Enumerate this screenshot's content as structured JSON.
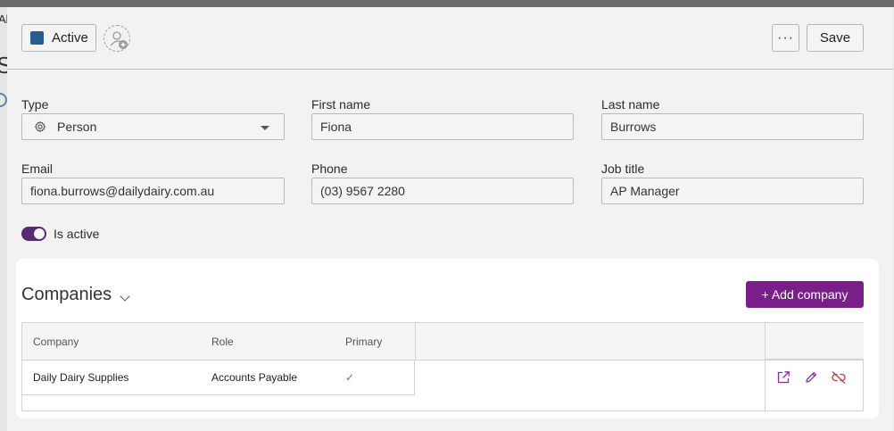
{
  "background": {
    "partial_text": "Al",
    "partial_heading": "S"
  },
  "header": {
    "status_label": "Active",
    "status_color": "#2a5d8f",
    "more_label": "···",
    "save_label": "Save"
  },
  "form": {
    "type": {
      "label": "Type",
      "value": "Person"
    },
    "first_name": {
      "label": "First name",
      "value": "Fiona"
    },
    "last_name": {
      "label": "Last name",
      "value": "Burrows"
    },
    "email": {
      "label": "Email",
      "value": "fiona.burrows@dailydairy.com.au"
    },
    "phone": {
      "label": "Phone",
      "value": "(03) 9567 2280"
    },
    "job_title": {
      "label": "Job title",
      "value": "AP Manager"
    },
    "is_active": {
      "label": "Is active",
      "value": true
    }
  },
  "companies": {
    "title": "Companies",
    "add_button": "+ Add company",
    "accent": "#7a1f8a",
    "columns": [
      "Company",
      "Role",
      "Primary"
    ],
    "rows": [
      {
        "company": "Daily Dairy Supplies",
        "role": "Accounts Payable",
        "primary": "✓"
      }
    ],
    "row_actions": [
      "open-external-icon",
      "edit-pencil-icon",
      "unlink-icon"
    ]
  }
}
